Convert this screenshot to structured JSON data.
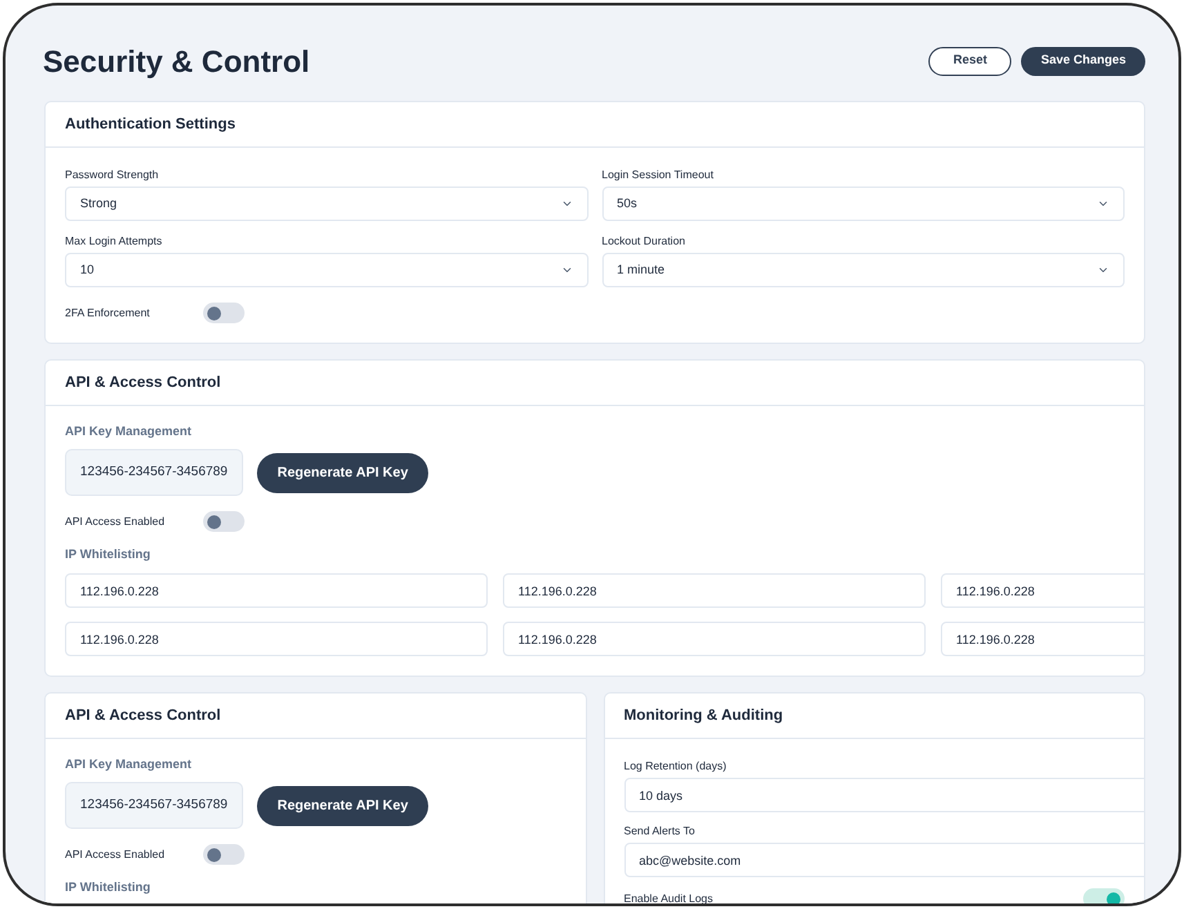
{
  "page": {
    "title": "Security & Control"
  },
  "actions": [
    {
      "label": "Reset",
      "kind": "outline"
    },
    {
      "label": "Save Changes",
      "kind": "primary"
    }
  ],
  "authentication": {
    "title": "Authentication Settings",
    "selects": [
      {
        "label": "Password Strength",
        "value": "Strong"
      },
      {
        "label": "Login Session Timeout",
        "value": "50s"
      },
      {
        "label": "Max Login Attempts",
        "value": "10"
      },
      {
        "label": "Lockout Duration",
        "value": "1 minute"
      }
    ],
    "toggle": {
      "label": "2FA Enforcement",
      "on": false
    }
  },
  "api_access": {
    "title": "API & Access Control",
    "key_label": "API Key Management",
    "api_key": "123456-234567-3456789",
    "regenerate_label": "Regenerate API Key",
    "toggle": {
      "label": "API Access Enabled",
      "on": false
    },
    "whitelist_label": "IP Whitelisting",
    "ips": [
      "112.196.0.228",
      "112.196.0.228",
      "112.196.0.228",
      "112.196.0.228",
      "112.196.0.228",
      "112.196.0.228"
    ]
  },
  "api_access_2": {
    "title": "API & Access Control",
    "key_label": "API Key Management",
    "api_key": "123456-234567-3456789",
    "regenerate_label": "Regenerate API Key",
    "toggle": {
      "label": "API Access Enabled",
      "on": false
    },
    "whitelist_label": "IP Whitelisting"
  },
  "monitoring": {
    "title": "Monitoring & Auditing",
    "fields": [
      {
        "label": "Log Retention (days)",
        "value": "10 days"
      },
      {
        "label": "Send Alerts To",
        "value": "abc@website.com"
      }
    ],
    "toggle": {
      "label": "Enable Audit Logs",
      "on": true
    }
  }
}
